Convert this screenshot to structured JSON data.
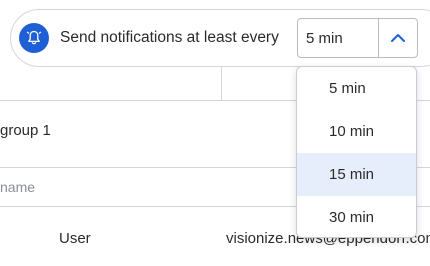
{
  "notification": {
    "label": "Send notifications at least every",
    "selected_value": "5 min",
    "bell_color": "#1f5fd6",
    "options": [
      {
        "label": "5 min"
      },
      {
        "label": "10 min"
      },
      {
        "label": "15 min",
        "highlighted": true
      },
      {
        "label": "30 min"
      }
    ]
  },
  "table": {
    "group_row": {
      "name": "group 1"
    },
    "name_field": {
      "placeholder": "name"
    },
    "user_row": {
      "role": "User",
      "email": "visionize.news@eppendorf.com"
    }
  }
}
